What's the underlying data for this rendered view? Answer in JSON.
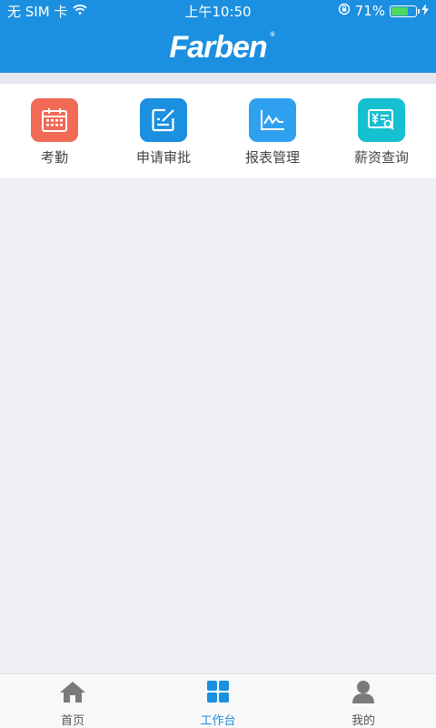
{
  "status_bar": {
    "carrier": "无 SIM 卡",
    "time": "上午10:50",
    "battery_percent": "71%",
    "battery_level": 0.71
  },
  "header": {
    "logo_text": "Farben",
    "logo_mark": "®"
  },
  "workbench": {
    "items": [
      {
        "label": "考勤",
        "icon": "calendar-icon",
        "color": "#f06a56"
      },
      {
        "label": "申请审批",
        "icon": "edit-document-icon",
        "color": "#1b8fe0"
      },
      {
        "label": "报表管理",
        "icon": "line-chart-icon",
        "color": "#2fa0f0"
      },
      {
        "label": "薪资查询",
        "icon": "salary-search-icon",
        "color": "#17c0d0"
      }
    ]
  },
  "tabbar": {
    "tabs": [
      {
        "label": "首页",
        "icon": "home-icon",
        "active": false
      },
      {
        "label": "工作台",
        "icon": "grid-icon",
        "active": true
      },
      {
        "label": "我的",
        "icon": "user-icon",
        "active": false
      }
    ],
    "active_color": "#1b8fe0",
    "inactive_icon_color": "#7a7a7a"
  }
}
